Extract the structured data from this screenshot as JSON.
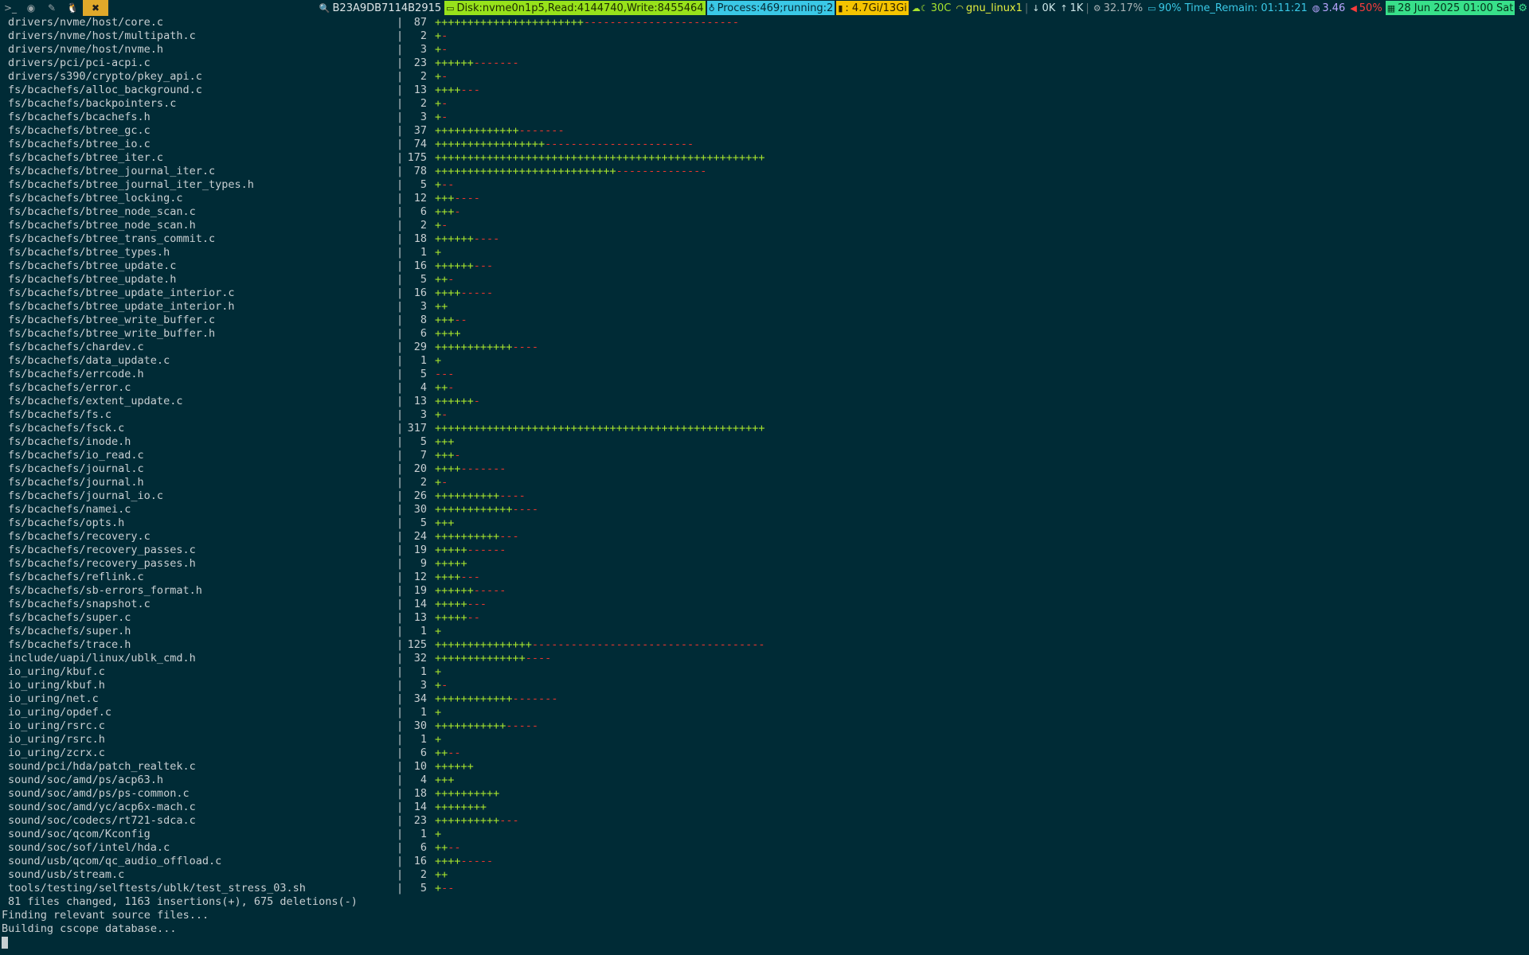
{
  "topbar": {
    "workspaces": [
      {
        "icon": "terminal-icon",
        "glyph": ">_",
        "active": false
      },
      {
        "icon": "browser-icon",
        "glyph": "◉",
        "active": false
      },
      {
        "icon": "edit-icon",
        "glyph": "✎",
        "active": false
      },
      {
        "icon": "linux-icon",
        "glyph": "🐧",
        "active": false
      },
      {
        "icon": "tools-icon",
        "glyph": "✖",
        "active": true
      }
    ],
    "host": "B23A9DB7114B2915",
    "disk": "Disk:nvme0n1p5,Read:4144740,Write:8455464",
    "process": "Process:469;running:2",
    "memory": ": 4.7Gi/13Gi",
    "temp": "30C",
    "wifi": "gnu_linux1",
    "net_down": "0K",
    "net_up": "1K",
    "cpu": "32.17%",
    "battery": "90% Time_Remain: 01:11:21",
    "load": "3.46",
    "volume": "50%",
    "date": "28 Jun 2025 01:00 Sat"
  },
  "terminal": {
    "files": [
      {
        "name": "drivers/nvme/host/core.c",
        "count": "87",
        "plus": 23,
        "minus": 24
      },
      {
        "name": "drivers/nvme/host/multipath.c",
        "count": "2",
        "plus": 1,
        "minus": 1
      },
      {
        "name": "drivers/nvme/host/nvme.h",
        "count": "3",
        "plus": 1,
        "minus": 1
      },
      {
        "name": "drivers/pci/pci-acpi.c",
        "count": "23",
        "plus": 6,
        "minus": 7
      },
      {
        "name": "drivers/s390/crypto/pkey_api.c",
        "count": "2",
        "plus": 1,
        "minus": 1
      },
      {
        "name": "fs/bcachefs/alloc_background.c",
        "count": "13",
        "plus": 4,
        "minus": 3
      },
      {
        "name": "fs/bcachefs/backpointers.c",
        "count": "2",
        "plus": 1,
        "minus": 1
      },
      {
        "name": "fs/bcachefs/bcachefs.h",
        "count": "3",
        "plus": 1,
        "minus": 1
      },
      {
        "name": "fs/bcachefs/btree_gc.c",
        "count": "37",
        "plus": 13,
        "minus": 7
      },
      {
        "name": "fs/bcachefs/btree_io.c",
        "count": "74",
        "plus": 17,
        "minus": 23
      },
      {
        "name": "fs/bcachefs/btree_iter.c",
        "count": "175",
        "plus": 51,
        "minus": 0
      },
      {
        "name": "fs/bcachefs/btree_journal_iter.c",
        "count": "78",
        "plus": 28,
        "minus": 14
      },
      {
        "name": "fs/bcachefs/btree_journal_iter_types.h",
        "count": "5",
        "plus": 1,
        "minus": 2
      },
      {
        "name": "fs/bcachefs/btree_locking.c",
        "count": "12",
        "plus": 3,
        "minus": 4
      },
      {
        "name": "fs/bcachefs/btree_node_scan.c",
        "count": "6",
        "plus": 3,
        "minus": 1
      },
      {
        "name": "fs/bcachefs/btree_node_scan.h",
        "count": "2",
        "plus": 1,
        "minus": 1
      },
      {
        "name": "fs/bcachefs/btree_trans_commit.c",
        "count": "18",
        "plus": 6,
        "minus": 4
      },
      {
        "name": "fs/bcachefs/btree_types.h",
        "count": "1",
        "plus": 1,
        "minus": 0
      },
      {
        "name": "fs/bcachefs/btree_update.c",
        "count": "16",
        "plus": 6,
        "minus": 3
      },
      {
        "name": "fs/bcachefs/btree_update.h",
        "count": "5",
        "plus": 2,
        "minus": 1
      },
      {
        "name": "fs/bcachefs/btree_update_interior.c",
        "count": "16",
        "plus": 4,
        "minus": 5
      },
      {
        "name": "fs/bcachefs/btree_update_interior.h",
        "count": "3",
        "plus": 2,
        "minus": 0
      },
      {
        "name": "fs/bcachefs/btree_write_buffer.c",
        "count": "8",
        "plus": 3,
        "minus": 2
      },
      {
        "name": "fs/bcachefs/btree_write_buffer.h",
        "count": "6",
        "plus": 4,
        "minus": 0
      },
      {
        "name": "fs/bcachefs/chardev.c",
        "count": "29",
        "plus": 12,
        "minus": 4
      },
      {
        "name": "fs/bcachefs/data_update.c",
        "count": "1",
        "plus": 1,
        "minus": 0
      },
      {
        "name": "fs/bcachefs/errcode.h",
        "count": "5",
        "plus": 0,
        "minus": 3
      },
      {
        "name": "fs/bcachefs/error.c",
        "count": "4",
        "plus": 2,
        "minus": 1
      },
      {
        "name": "fs/bcachefs/extent_update.c",
        "count": "13",
        "plus": 6,
        "minus": 1
      },
      {
        "name": "fs/bcachefs/fs.c",
        "count": "3",
        "plus": 1,
        "minus": 1
      },
      {
        "name": "fs/bcachefs/fsck.c",
        "count": "317",
        "plus": 51,
        "minus": 0
      },
      {
        "name": "fs/bcachefs/inode.h",
        "count": "5",
        "plus": 3,
        "minus": 0
      },
      {
        "name": "fs/bcachefs/io_read.c",
        "count": "7",
        "plus": 3,
        "minus": 1
      },
      {
        "name": "fs/bcachefs/journal.c",
        "count": "20",
        "plus": 4,
        "minus": 7
      },
      {
        "name": "fs/bcachefs/journal.h",
        "count": "2",
        "plus": 1,
        "minus": 1
      },
      {
        "name": "fs/bcachefs/journal_io.c",
        "count": "26",
        "plus": 10,
        "minus": 4
      },
      {
        "name": "fs/bcachefs/namei.c",
        "count": "30",
        "plus": 12,
        "minus": 4
      },
      {
        "name": "fs/bcachefs/opts.h",
        "count": "5",
        "plus": 3,
        "minus": 0
      },
      {
        "name": "fs/bcachefs/recovery.c",
        "count": "24",
        "plus": 10,
        "minus": 3
      },
      {
        "name": "fs/bcachefs/recovery_passes.c",
        "count": "19",
        "plus": 5,
        "minus": 6
      },
      {
        "name": "fs/bcachefs/recovery_passes.h",
        "count": "9",
        "plus": 5,
        "minus": 0
      },
      {
        "name": "fs/bcachefs/reflink.c",
        "count": "12",
        "plus": 4,
        "minus": 3
      },
      {
        "name": "fs/bcachefs/sb-errors_format.h",
        "count": "19",
        "plus": 6,
        "minus": 5
      },
      {
        "name": "fs/bcachefs/snapshot.c",
        "count": "14",
        "plus": 5,
        "minus": 3
      },
      {
        "name": "fs/bcachefs/super.c",
        "count": "13",
        "plus": 5,
        "minus": 2
      },
      {
        "name": "fs/bcachefs/super.h",
        "count": "1",
        "plus": 1,
        "minus": 0
      },
      {
        "name": "fs/bcachefs/trace.h",
        "count": "125",
        "plus": 15,
        "minus": 36
      },
      {
        "name": "include/uapi/linux/ublk_cmd.h",
        "count": "32",
        "plus": 14,
        "minus": 4
      },
      {
        "name": "io_uring/kbuf.c",
        "count": "1",
        "plus": 1,
        "minus": 0
      },
      {
        "name": "io_uring/kbuf.h",
        "count": "3",
        "plus": 1,
        "minus": 1
      },
      {
        "name": "io_uring/net.c",
        "count": "34",
        "plus": 12,
        "minus": 7
      },
      {
        "name": "io_uring/opdef.c",
        "count": "1",
        "plus": 1,
        "minus": 0
      },
      {
        "name": "io_uring/rsrc.c",
        "count": "30",
        "plus": 11,
        "minus": 5
      },
      {
        "name": "io_uring/rsrc.h",
        "count": "1",
        "plus": 1,
        "minus": 0
      },
      {
        "name": "io_uring/zcrx.c",
        "count": "6",
        "plus": 2,
        "minus": 2
      },
      {
        "name": "sound/pci/hda/patch_realtek.c",
        "count": "10",
        "plus": 6,
        "minus": 0
      },
      {
        "name": "sound/soc/amd/ps/acp63.h",
        "count": "4",
        "plus": 3,
        "minus": 0
      },
      {
        "name": "sound/soc/amd/ps/ps-common.c",
        "count": "18",
        "plus": 10,
        "minus": 0
      },
      {
        "name": "sound/soc/amd/yc/acp6x-mach.c",
        "count": "14",
        "plus": 8,
        "minus": 0
      },
      {
        "name": "sound/soc/codecs/rt721-sdca.c",
        "count": "23",
        "plus": 10,
        "minus": 3
      },
      {
        "name": "sound/soc/qcom/Kconfig",
        "count": "1",
        "plus": 1,
        "minus": 0
      },
      {
        "name": "sound/soc/sof/intel/hda.c",
        "count": "6",
        "plus": 2,
        "minus": 2
      },
      {
        "name": "sound/usb/qcom/qc_audio_offload.c",
        "count": "16",
        "plus": 4,
        "minus": 5
      },
      {
        "name": "sound/usb/stream.c",
        "count": "2",
        "plus": 2,
        "minus": 0
      },
      {
        "name": "tools/testing/selftests/ublk/test_stress_03.sh",
        "count": "5",
        "plus": 1,
        "minus": 2
      }
    ],
    "summary": "81 files changed, 1163 insertions(+), 675 deletions(-)",
    "messages": [
      "Finding relevant source files...",
      "Building cscope database..."
    ]
  }
}
